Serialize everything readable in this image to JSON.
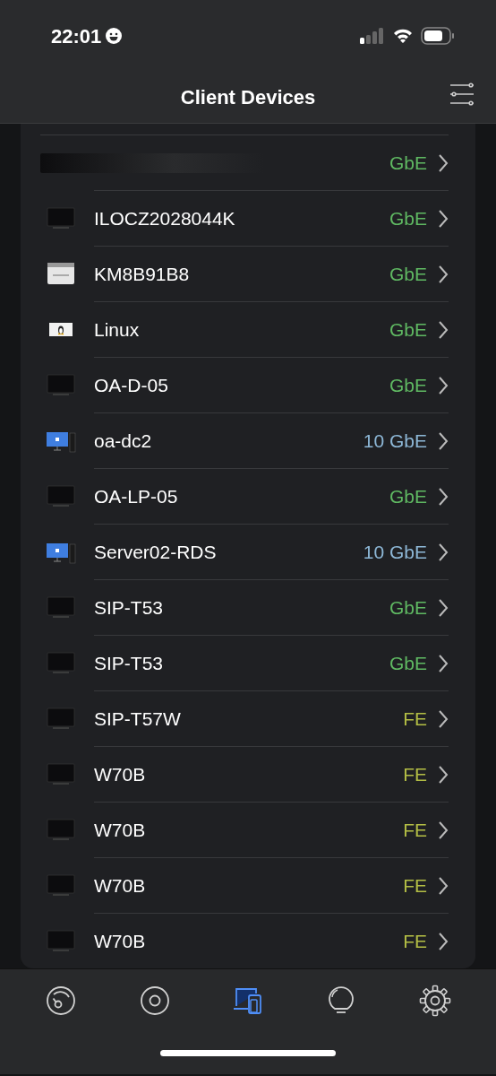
{
  "status_bar": {
    "time": "22:01"
  },
  "header": {
    "title": "Client Devices"
  },
  "devices": [
    {
      "kind": "redacted",
      "speed": "GbE",
      "color": "#5fb862"
    },
    {
      "kind": "monitor",
      "name": "ILOCZ2028044K",
      "speed": "GbE",
      "color": "#5fb862"
    },
    {
      "kind": "printer",
      "name": "KM8B91B8",
      "speed": "GbE",
      "color": "#5fb862"
    },
    {
      "kind": "linux",
      "name": "Linux",
      "speed": "GbE",
      "color": "#5fb862"
    },
    {
      "kind": "monitor",
      "name": "OA-D-05",
      "speed": "GbE",
      "color": "#5fb862"
    },
    {
      "kind": "windows",
      "name": "oa-dc2",
      "speed": "10 GbE",
      "color": "#8db7d6"
    },
    {
      "kind": "monitor",
      "name": "OA-LP-05",
      "speed": "GbE",
      "color": "#5fb862"
    },
    {
      "kind": "windows",
      "name": "Server02-RDS",
      "speed": "10 GbE",
      "color": "#8db7d6"
    },
    {
      "kind": "monitor",
      "name": "SIP-T53",
      "speed": "GbE",
      "color": "#5fb862"
    },
    {
      "kind": "monitor",
      "name": "SIP-T53",
      "speed": "GbE",
      "color": "#5fb862"
    },
    {
      "kind": "monitor",
      "name": "SIP-T57W",
      "speed": "FE",
      "color": "#b3bd45"
    },
    {
      "kind": "monitor",
      "name": "W70B",
      "speed": "FE",
      "color": "#b3bd45"
    },
    {
      "kind": "monitor",
      "name": "W70B",
      "speed": "FE",
      "color": "#b3bd45"
    },
    {
      "kind": "monitor",
      "name": "W70B",
      "speed": "FE",
      "color": "#b3bd45"
    },
    {
      "kind": "monitor",
      "name": "W70B",
      "speed": "FE",
      "color": "#b3bd45"
    }
  ],
  "tab_bar": [
    {
      "kind": "gauge",
      "selected": false
    },
    {
      "kind": "disc",
      "selected": false
    },
    {
      "kind": "devices",
      "selected": true
    },
    {
      "kind": "bulb",
      "selected": false
    },
    {
      "kind": "gear",
      "selected": false
    }
  ]
}
